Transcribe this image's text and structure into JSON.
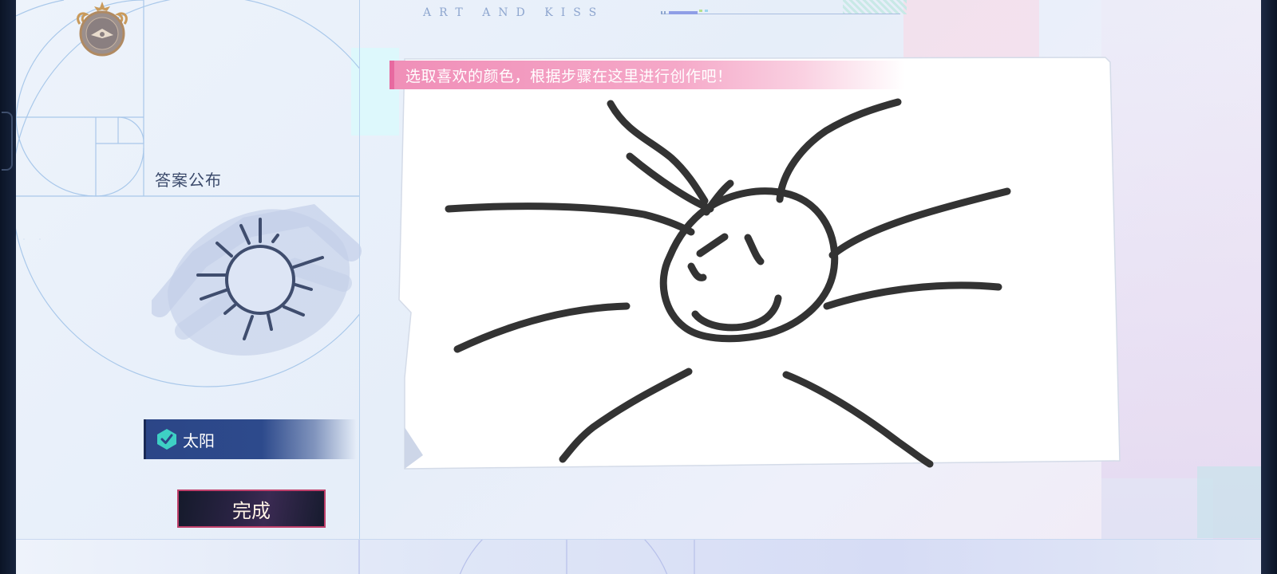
{
  "header": {
    "brand": "ART AND KISS"
  },
  "instruction": {
    "text": "选取喜欢的颜色，根据步骤在这里进行创作吧！"
  },
  "answer": {
    "label": "答案公布",
    "result": "太阳"
  },
  "actions": {
    "done_label": "完成"
  },
  "colors": {
    "instruction_banner": "#f08fb8",
    "answer_tag": "#2c4687",
    "check_icon": "#3ed0c4",
    "stroke": "#333333",
    "done_border": "#c0406b"
  },
  "icons": [
    "compass-emblem-icon",
    "check-badge-icon",
    "sun-reference-icon"
  ]
}
